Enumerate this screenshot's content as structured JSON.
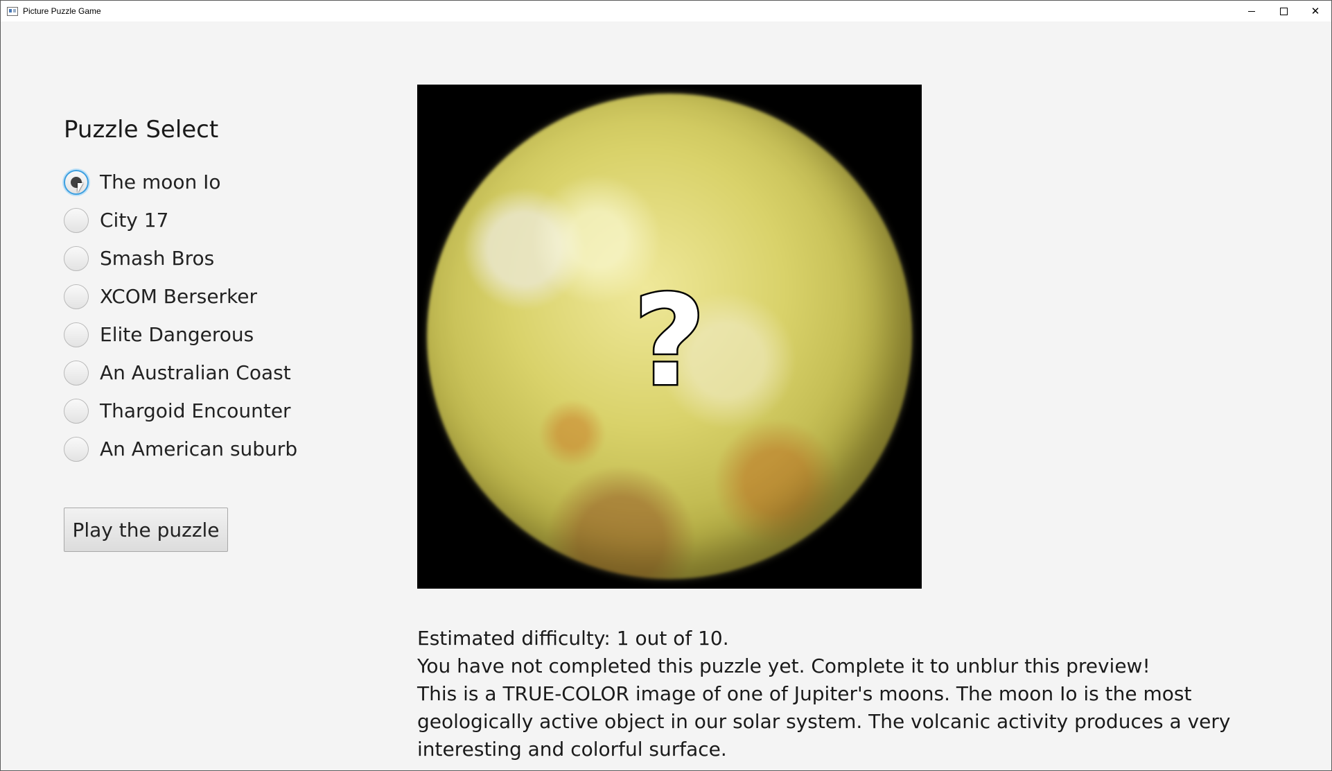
{
  "window": {
    "title": "Picture Puzzle Game",
    "controls": {
      "minimize": "minimize",
      "maximize": "maximize",
      "close": "✕"
    }
  },
  "puzzle_select": {
    "heading": "Puzzle Select",
    "options": [
      {
        "label": "The moon Io",
        "selected": true
      },
      {
        "label": "City 17",
        "selected": false
      },
      {
        "label": "Smash Bros",
        "selected": false
      },
      {
        "label": "XCOM Berserker",
        "selected": false
      },
      {
        "label": "Elite Dangerous",
        "selected": false
      },
      {
        "label": "An Australian Coast",
        "selected": false
      },
      {
        "label": "Thargoid Encounter",
        "selected": false
      },
      {
        "label": "An American suburb",
        "selected": false
      }
    ]
  },
  "play_button": {
    "label": "Play the puzzle"
  },
  "preview": {
    "overlay_symbol": "?",
    "colors": {
      "moon": "#d9d26a",
      "background": "#000000"
    }
  },
  "info": {
    "difficulty": "Estimated difficulty: 1 out of 10.",
    "status": "You have not completed this puzzle yet. Complete it to unblur this preview!",
    "description": "This is a TRUE-COLOR image of one of Jupiter's moons. The moon Io is the most geologically active object in our solar system. The volcanic activity produces a very interesting and colorful surface."
  },
  "colors": {
    "accent": "#3c9fe0",
    "background": "#f4f4f4"
  }
}
